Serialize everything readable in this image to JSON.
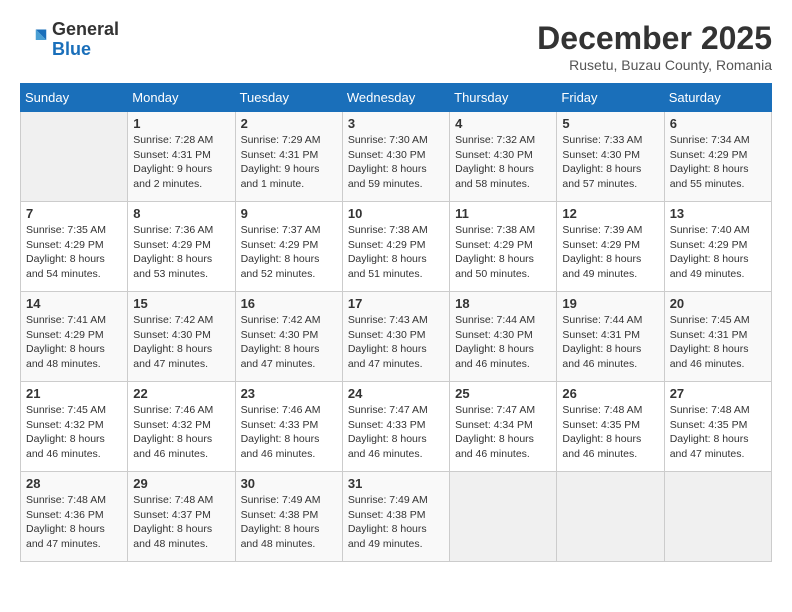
{
  "header": {
    "logo_general": "General",
    "logo_blue": "Blue",
    "month_title": "December 2025",
    "subtitle": "Rusetu, Buzau County, Romania"
  },
  "days_of_week": [
    "Sunday",
    "Monday",
    "Tuesday",
    "Wednesday",
    "Thursday",
    "Friday",
    "Saturday"
  ],
  "weeks": [
    [
      {
        "day": "",
        "sunrise": "",
        "sunset": "",
        "daylight": ""
      },
      {
        "day": "1",
        "sunrise": "7:28 AM",
        "sunset": "4:31 PM",
        "daylight": "9 hours and 2 minutes."
      },
      {
        "day": "2",
        "sunrise": "7:29 AM",
        "sunset": "4:31 PM",
        "daylight": "9 hours and 1 minute."
      },
      {
        "day": "3",
        "sunrise": "7:30 AM",
        "sunset": "4:30 PM",
        "daylight": "8 hours and 59 minutes."
      },
      {
        "day": "4",
        "sunrise": "7:32 AM",
        "sunset": "4:30 PM",
        "daylight": "8 hours and 58 minutes."
      },
      {
        "day": "5",
        "sunrise": "7:33 AM",
        "sunset": "4:30 PM",
        "daylight": "8 hours and 57 minutes."
      },
      {
        "day": "6",
        "sunrise": "7:34 AM",
        "sunset": "4:29 PM",
        "daylight": "8 hours and 55 minutes."
      }
    ],
    [
      {
        "day": "7",
        "sunrise": "7:35 AM",
        "sunset": "4:29 PM",
        "daylight": "8 hours and 54 minutes."
      },
      {
        "day": "8",
        "sunrise": "7:36 AM",
        "sunset": "4:29 PM",
        "daylight": "8 hours and 53 minutes."
      },
      {
        "day": "9",
        "sunrise": "7:37 AM",
        "sunset": "4:29 PM",
        "daylight": "8 hours and 52 minutes."
      },
      {
        "day": "10",
        "sunrise": "7:38 AM",
        "sunset": "4:29 PM",
        "daylight": "8 hours and 51 minutes."
      },
      {
        "day": "11",
        "sunrise": "7:38 AM",
        "sunset": "4:29 PM",
        "daylight": "8 hours and 50 minutes."
      },
      {
        "day": "12",
        "sunrise": "7:39 AM",
        "sunset": "4:29 PM",
        "daylight": "8 hours and 49 minutes."
      },
      {
        "day": "13",
        "sunrise": "7:40 AM",
        "sunset": "4:29 PM",
        "daylight": "8 hours and 49 minutes."
      }
    ],
    [
      {
        "day": "14",
        "sunrise": "7:41 AM",
        "sunset": "4:29 PM",
        "daylight": "8 hours and 48 minutes."
      },
      {
        "day": "15",
        "sunrise": "7:42 AM",
        "sunset": "4:30 PM",
        "daylight": "8 hours and 47 minutes."
      },
      {
        "day": "16",
        "sunrise": "7:42 AM",
        "sunset": "4:30 PM",
        "daylight": "8 hours and 47 minutes."
      },
      {
        "day": "17",
        "sunrise": "7:43 AM",
        "sunset": "4:30 PM",
        "daylight": "8 hours and 47 minutes."
      },
      {
        "day": "18",
        "sunrise": "7:44 AM",
        "sunset": "4:30 PM",
        "daylight": "8 hours and 46 minutes."
      },
      {
        "day": "19",
        "sunrise": "7:44 AM",
        "sunset": "4:31 PM",
        "daylight": "8 hours and 46 minutes."
      },
      {
        "day": "20",
        "sunrise": "7:45 AM",
        "sunset": "4:31 PM",
        "daylight": "8 hours and 46 minutes."
      }
    ],
    [
      {
        "day": "21",
        "sunrise": "7:45 AM",
        "sunset": "4:32 PM",
        "daylight": "8 hours and 46 minutes."
      },
      {
        "day": "22",
        "sunrise": "7:46 AM",
        "sunset": "4:32 PM",
        "daylight": "8 hours and 46 minutes."
      },
      {
        "day": "23",
        "sunrise": "7:46 AM",
        "sunset": "4:33 PM",
        "daylight": "8 hours and 46 minutes."
      },
      {
        "day": "24",
        "sunrise": "7:47 AM",
        "sunset": "4:33 PM",
        "daylight": "8 hours and 46 minutes."
      },
      {
        "day": "25",
        "sunrise": "7:47 AM",
        "sunset": "4:34 PM",
        "daylight": "8 hours and 46 minutes."
      },
      {
        "day": "26",
        "sunrise": "7:48 AM",
        "sunset": "4:35 PM",
        "daylight": "8 hours and 46 minutes."
      },
      {
        "day": "27",
        "sunrise": "7:48 AM",
        "sunset": "4:35 PM",
        "daylight": "8 hours and 47 minutes."
      }
    ],
    [
      {
        "day": "28",
        "sunrise": "7:48 AM",
        "sunset": "4:36 PM",
        "daylight": "8 hours and 47 minutes."
      },
      {
        "day": "29",
        "sunrise": "7:48 AM",
        "sunset": "4:37 PM",
        "daylight": "8 hours and 48 minutes."
      },
      {
        "day": "30",
        "sunrise": "7:49 AM",
        "sunset": "4:38 PM",
        "daylight": "8 hours and 48 minutes."
      },
      {
        "day": "31",
        "sunrise": "7:49 AM",
        "sunset": "4:38 PM",
        "daylight": "8 hours and 49 minutes."
      },
      {
        "day": "",
        "sunrise": "",
        "sunset": "",
        "daylight": ""
      },
      {
        "day": "",
        "sunrise": "",
        "sunset": "",
        "daylight": ""
      },
      {
        "day": "",
        "sunrise": "",
        "sunset": "",
        "daylight": ""
      }
    ]
  ]
}
